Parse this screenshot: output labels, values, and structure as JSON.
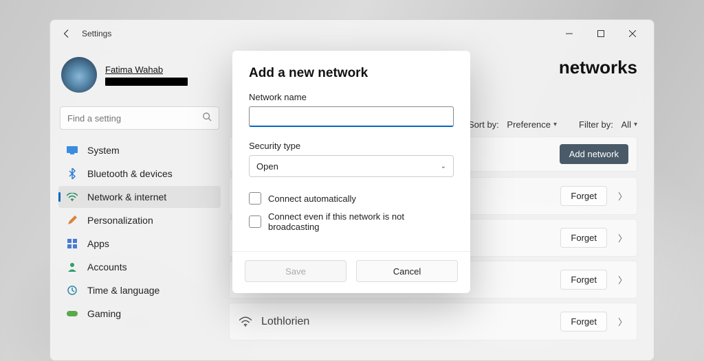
{
  "window": {
    "app_title": "Settings"
  },
  "profile": {
    "name": "Fatima Wahab"
  },
  "search": {
    "placeholder": "Find a setting"
  },
  "sidebar": {
    "items": [
      {
        "label": "System",
        "icon": "system-icon"
      },
      {
        "label": "Bluetooth & devices",
        "icon": "bluetooth-icon"
      },
      {
        "label": "Network & internet",
        "icon": "network-icon"
      },
      {
        "label": "Personalization",
        "icon": "personalization-icon"
      },
      {
        "label": "Apps",
        "icon": "apps-icon"
      },
      {
        "label": "Accounts",
        "icon": "accounts-icon"
      },
      {
        "label": "Time & language",
        "icon": "time-language-icon"
      },
      {
        "label": "Gaming",
        "icon": "gaming-icon"
      }
    ]
  },
  "page": {
    "heading_visible_fragment": "networks"
  },
  "controls": {
    "sort_prefix": "Sort by:",
    "sort_value": "Preference",
    "filter_prefix": "Filter by:",
    "filter_value": "All",
    "add_network_label": "Add network",
    "forget_label": "Forget"
  },
  "networks": [
    {
      "name": ""
    },
    {
      "name": ""
    },
    {
      "name": ""
    },
    {
      "name": "Lothlorien"
    }
  ],
  "dialog": {
    "title": "Add a new network",
    "network_name_label": "Network name",
    "network_name_value": "",
    "security_type_label": "Security type",
    "security_type_value": "Open",
    "connect_auto_label": "Connect automatically",
    "connect_hidden_label": "Connect even if this network is not broadcasting",
    "save_label": "Save",
    "cancel_label": "Cancel"
  }
}
